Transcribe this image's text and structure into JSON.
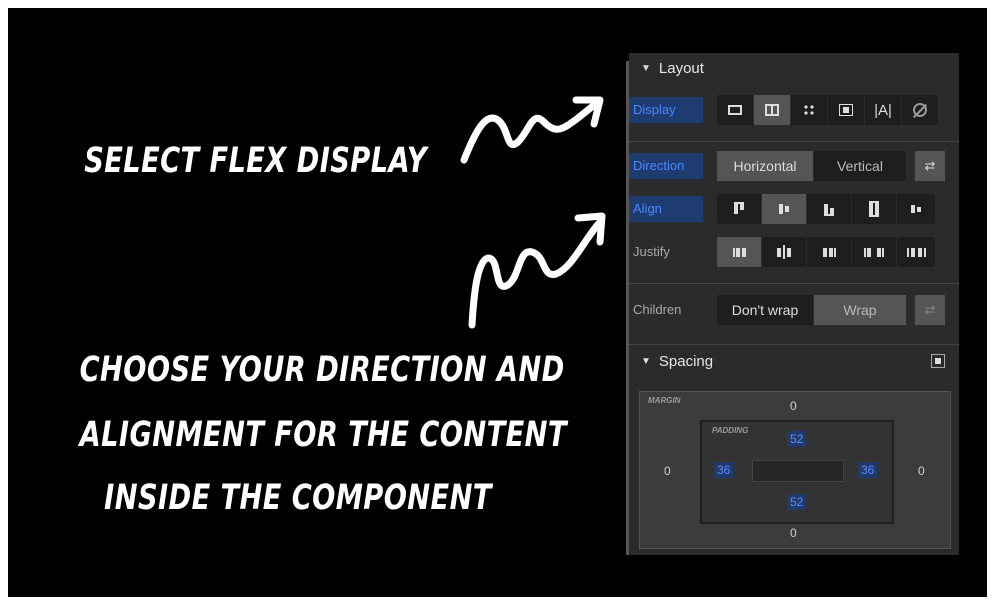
{
  "captions": {
    "select_flex": "SELECT FLEX DISPLAY",
    "choose_line1": "CHOOSE YOUR DIRECTION AND",
    "choose_line2": "ALIGNMENT FOR THE CONTENT",
    "choose_line3": "INSIDE THE COMPONENT"
  },
  "panel": {
    "layout_title": "Layout",
    "display_label": "Display",
    "display_options": [
      "block-icon",
      "flex-icon",
      "grid-icon",
      "inline-block-icon",
      "inline-icon",
      "none-icon"
    ],
    "display_inline_glyph": "|A|",
    "direction_label": "Direction",
    "direction_horizontal": "Horizontal",
    "direction_vertical": "Vertical",
    "align_label": "Align",
    "justify_label": "Justify",
    "children_label": "Children",
    "children_nowrap": "Don't wrap",
    "children_wrap": "Wrap",
    "spacing_title": "Spacing",
    "margin_tag": "MARGIN",
    "padding_tag": "PADDING",
    "margin": {
      "top": "0",
      "right": "0",
      "bottom": "0",
      "left": "0"
    },
    "padding": {
      "top": "52",
      "right": "36",
      "bottom": "52",
      "left": "36"
    }
  },
  "colors": {
    "accent_blue": "#4b86ff",
    "panel_bg": "#2b2b2b",
    "background": "#000000"
  }
}
